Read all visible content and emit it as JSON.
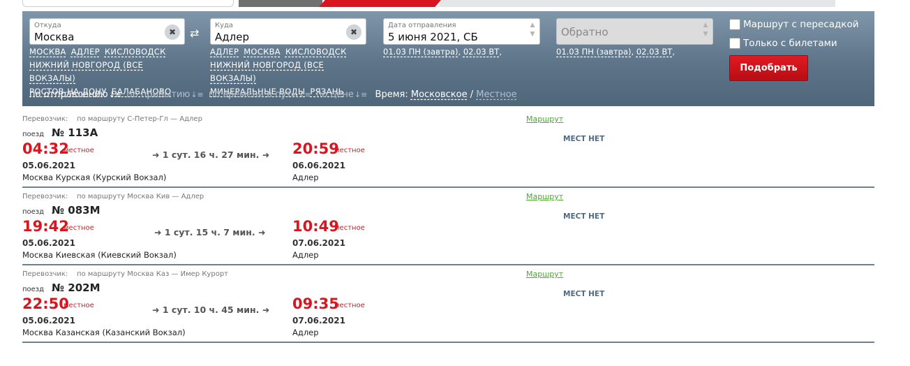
{
  "search": {
    "from_label": "Откуда",
    "from_value": "Москва",
    "to_label": "Куда",
    "to_value": "Адлер",
    "date_label": "Дата отправления",
    "date_value": "5 июня 2021, СБ",
    "return_placeholder": "Обратно",
    "from_quick": [
      "МОСКВА",
      "АДЛЕР",
      "КИСЛОВОДСК",
      "НИЖНИЙ НОВГОРОД (ВСЕ ВОКЗАЛЫ)",
      "РОСТОВ-НА-ДОНУ",
      "БАЛАБАНОВО"
    ],
    "to_quick": [
      "АДЛЕР",
      "МОСКВА",
      "КИСЛОВОДСК",
      "НИЖНИЙ НОВГОРОД (ВСЕ ВОКЗАЛЫ)",
      "МИНЕРАЛЬНЫЕ ВОДЫ",
      "РЯЗАНЬ"
    ],
    "date_hint1": "01.03 ПН (завтра)",
    "date_hint2": "02.03 ВТ",
    "return_hint1": "01.03 ПН (завтра)",
    "return_hint2": "02.03 ВТ",
    "transfer_label": "Маршрут с пересадкой",
    "tickets_only_label": "Только с билетами",
    "submit_label": "Подобрать"
  },
  "sort": {
    "by_departure": "по отправлению",
    "by_arrival": "по прибытию",
    "by_duration": "по времени в пути",
    "by_price": "по цене",
    "time_label": "Время:",
    "time_moscow": "Московское",
    "time_separator": "/",
    "time_local": "Местное"
  },
  "labels": {
    "carrier_prefix": "Перевозчик:",
    "train": "поезд",
    "route_link": "Маршрут",
    "local": "местное",
    "no_seats": "МЕСТ НЕТ"
  },
  "trains": [
    {
      "carrier": "по маршруту С-Петер-Гл — Адлер",
      "number": "№ 113А",
      "dep_time": "04:32",
      "duration": "1 сут. 16 ч. 27 мин.",
      "arr_time": "20:59",
      "dep_date": "05.06.2021",
      "arr_date": "06.06.2021",
      "dep_station": "Москва Курская (Курский Вокзал)",
      "arr_station": "Адлер"
    },
    {
      "carrier": "по маршруту Москва Кив — Адлер",
      "number": "№ 083М",
      "dep_time": "19:42",
      "duration": "1 сут. 15 ч. 7 мин.",
      "arr_time": "10:49",
      "dep_date": "05.06.2021",
      "arr_date": "07.06.2021",
      "dep_station": "Москва Киевская (Киевский Вокзал)",
      "arr_station": "Адлер"
    },
    {
      "carrier": "по маршруту Москва Каз — Имер Курорт",
      "number": "№ 202М",
      "dep_time": "22:50",
      "duration": "1 сут. 10 ч. 45 мин.",
      "arr_time": "09:35",
      "dep_date": "05.06.2021",
      "arr_date": "07.06.2021",
      "dep_station": "Москва Казанская (Казанский Вокзал)",
      "arr_station": "Адлер"
    }
  ]
}
